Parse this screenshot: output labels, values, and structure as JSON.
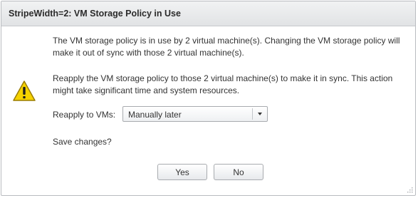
{
  "dialog": {
    "title": "StripeWidth=2: VM Storage Policy in Use",
    "message_in_use": "The VM storage policy is in use by 2 virtual machine(s). Changing the VM storage policy will make it out of sync with those 2 virtual machine(s).",
    "message_reapply": "Reapply the VM storage policy to those 2 virtual machine(s) to make it in sync. This action might take significant time and system resources.",
    "reapply_label": "Reapply to VMs:",
    "reapply_select": {
      "selected": "Manually later"
    },
    "save_question": "Save changes?",
    "buttons": {
      "yes": "Yes",
      "no": "No"
    },
    "icon": "warning-icon"
  },
  "colors": {
    "warning_fill": "#f5d200",
    "warning_border": "#9a7c00",
    "titlebar_top": "#f1f2f3",
    "titlebar_bottom": "#e1e3e5"
  }
}
